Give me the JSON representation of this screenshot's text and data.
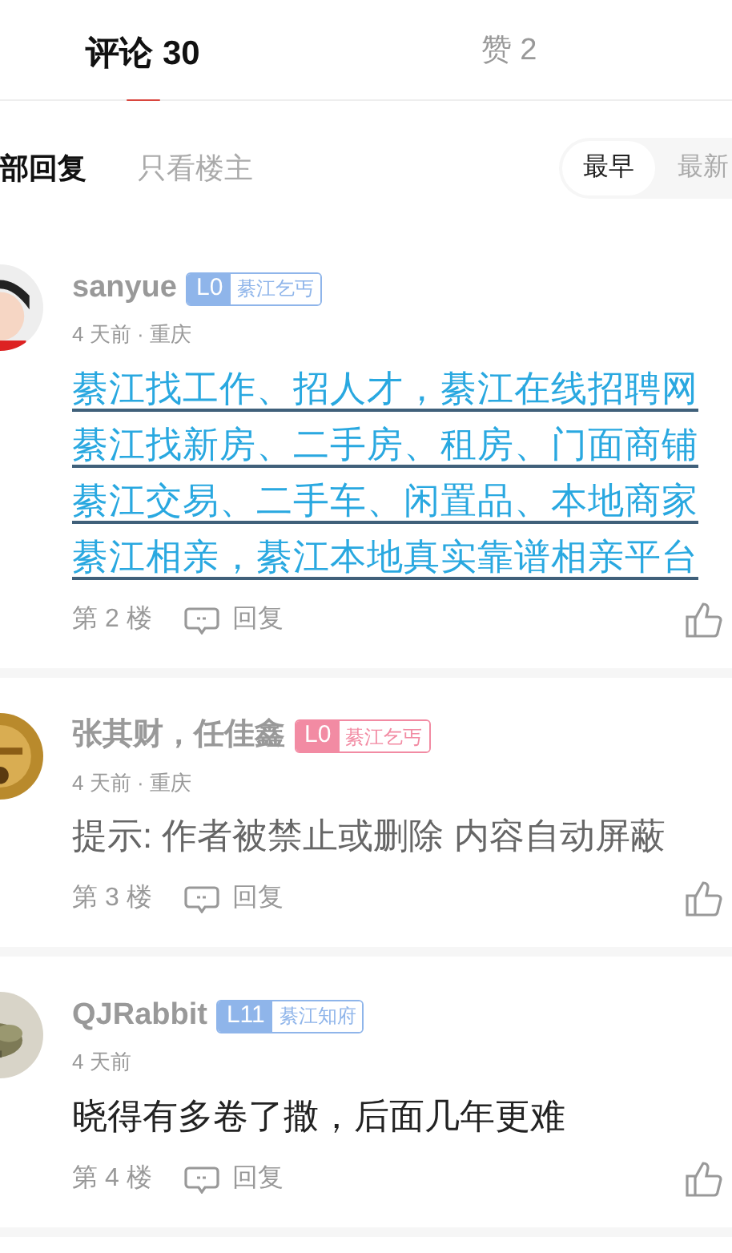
{
  "tabs": [
    {
      "label": "评论 30",
      "selected": true
    },
    {
      "label": "赞 2",
      "selected": false
    }
  ],
  "filters": [
    {
      "label": "部回复",
      "selected": true
    },
    {
      "label": "只看楼主",
      "selected": false
    }
  ],
  "sort": [
    {
      "label": "最早",
      "selected": true
    },
    {
      "label": "最新",
      "selected": false
    }
  ],
  "comments": [
    {
      "user": "sanyue",
      "level": "L0",
      "title": "綦江乞丐",
      "color": "#8fb5ea",
      "meta": "4 天前 · 重庆",
      "kind": "links",
      "lines": [
        "綦江找工作、招人才，綦江在线招聘网",
        "綦江找新房、二手房、租房、门面商铺",
        "綦江交易、二手车、闲置品、本地商家",
        "綦江相亲，綦江本地真实靠谱相亲平台"
      ],
      "floor": "第 2 楼",
      "reply": "回复"
    },
    {
      "user": "张其财，任佳鑫",
      "level": "L0",
      "title": "綦江乞丐",
      "color": "#f28ba3",
      "meta": "4 天前 · 重庆",
      "kind": "notice",
      "lines": [
        "提示: 作者被禁止或删除 内容自动屏蔽"
      ],
      "floor": "第 3 楼",
      "reply": "回复"
    },
    {
      "user": "QJRabbit",
      "level": "L11",
      "title": "綦江知府",
      "color": "#8fb5ea",
      "meta": "4 天前",
      "kind": "text",
      "lines": [
        "晓得有多卷了撒，后面几年更难"
      ],
      "floor": "第 4 楼",
      "reply": "回复"
    }
  ]
}
